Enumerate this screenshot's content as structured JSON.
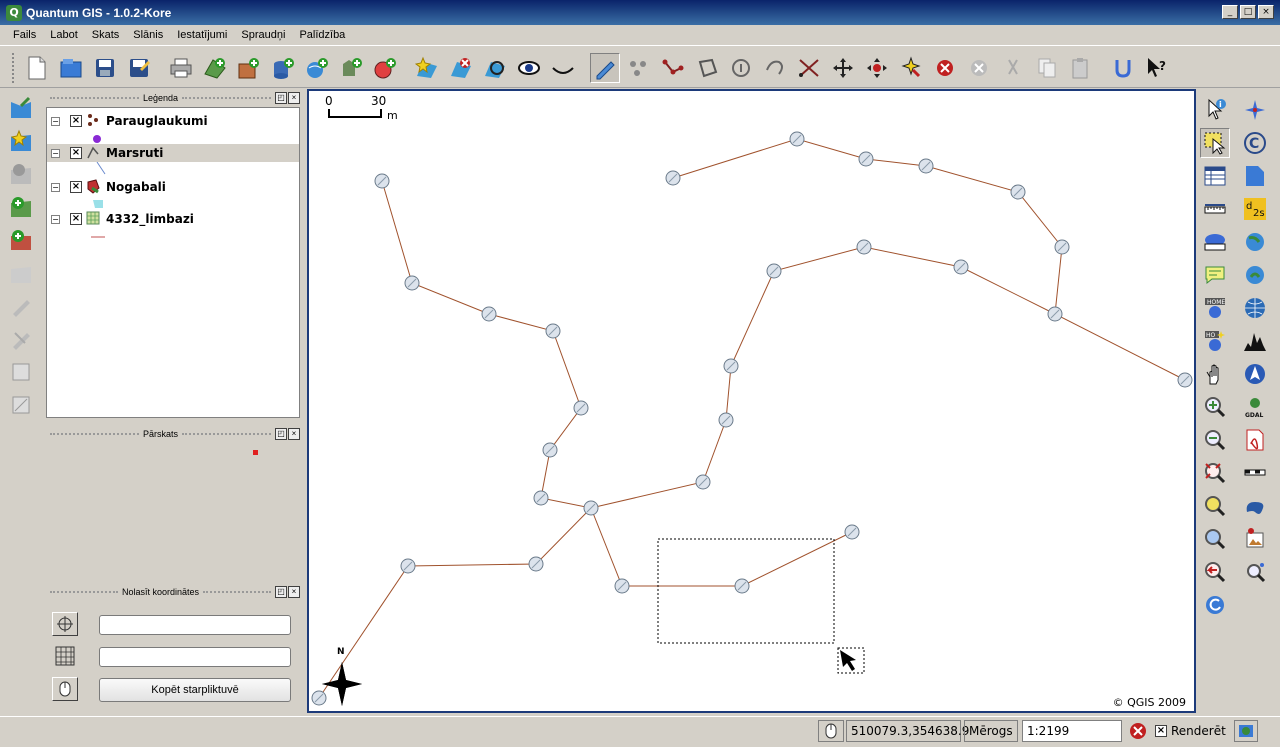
{
  "window": {
    "title": "Quantum GIS - 1.0.2-Kore",
    "app_icon": "Q",
    "controls": [
      "_",
      "□",
      "×"
    ]
  },
  "menu": [
    "Fails",
    "Labot",
    "Skats",
    "Slānis",
    "Iestatījumi",
    "Spraudņi",
    "Palīdzība"
  ],
  "panels": {
    "legend_title": "Leģenda",
    "overview_title": "Pārskats",
    "coords_title": "Nolasīt koordinātes",
    "float_btn": "◰",
    "close_btn": "×"
  },
  "layers": [
    {
      "name": "Parauglaukumi",
      "checked": "×",
      "expander": "−",
      "icon": "points-layer-icon",
      "selected": false
    },
    {
      "name": "Marsruti",
      "checked": "×",
      "expander": "−",
      "icon": "line-layer-icon",
      "selected": true
    },
    {
      "name": "Nogabali",
      "checked": "×",
      "expander": "−",
      "icon": "polygon-layer-icon",
      "selected": false
    },
    {
      "name": "4332_limbazi",
      "checked": "×",
      "expander": "−",
      "icon": "raster-layer-icon",
      "selected": false
    }
  ],
  "coords": {
    "x_value": "",
    "y_value": "",
    "copy_label": "Kopēt starpliktuvē"
  },
  "map": {
    "scalebar": {
      "start": "0",
      "end": "30",
      "unit": "m"
    },
    "north": "N",
    "copyright": "© QGIS 2009",
    "line_color": "#a0522d",
    "node_fill": "#dce3ec"
  },
  "status": {
    "coordinates": "510079.3,354638.9",
    "scale_label": "Mērogs",
    "scale_value": "1:2199",
    "render_label": "Renderēt",
    "render_checked": "×"
  }
}
